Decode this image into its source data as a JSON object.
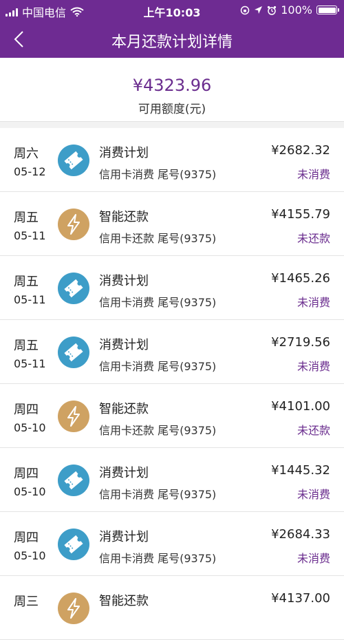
{
  "status_bar": {
    "carrier": "中国电信",
    "time": "上午10:03",
    "battery": "100%"
  },
  "nav": {
    "title": "本月还款计划详情"
  },
  "summary": {
    "amount": "¥4323.96",
    "label": "可用额度(元)"
  },
  "colors": {
    "brand": "#6e2b92",
    "consume_icon": "#3d9dc8",
    "repay_icon": "#cfa262",
    "status_text": "#6a2c8e"
  },
  "items": [
    {
      "weekday": "周六",
      "date": "05-12",
      "type": "consume",
      "icon": "ticket-icon",
      "name": "消费计划",
      "card": "信用卡消费  尾号(9375)",
      "amount": "¥2682.32",
      "status": "未消费"
    },
    {
      "weekday": "周五",
      "date": "05-11",
      "type": "repay",
      "icon": "lightning-icon",
      "name": "智能还款",
      "card": "信用卡还款  尾号(9375)",
      "amount": "¥4155.79",
      "status": "未还款"
    },
    {
      "weekday": "周五",
      "date": "05-11",
      "type": "consume",
      "icon": "ticket-icon",
      "name": "消费计划",
      "card": "信用卡消费  尾号(9375)",
      "amount": "¥1465.26",
      "status": "未消费"
    },
    {
      "weekday": "周五",
      "date": "05-11",
      "type": "consume",
      "icon": "ticket-icon",
      "name": "消费计划",
      "card": "信用卡消费  尾号(9375)",
      "amount": "¥2719.56",
      "status": "未消费"
    },
    {
      "weekday": "周四",
      "date": "05-10",
      "type": "repay",
      "icon": "lightning-icon",
      "name": "智能还款",
      "card": "信用卡还款  尾号(9375)",
      "amount": "¥4101.00",
      "status": "未还款"
    },
    {
      "weekday": "周四",
      "date": "05-10",
      "type": "consume",
      "icon": "ticket-icon",
      "name": "消费计划",
      "card": "信用卡消费  尾号(9375)",
      "amount": "¥1445.32",
      "status": "未消费"
    },
    {
      "weekday": "周四",
      "date": "05-10",
      "type": "consume",
      "icon": "ticket-icon",
      "name": "消费计划",
      "card": "信用卡消费  尾号(9375)",
      "amount": "¥2684.33",
      "status": "未消费"
    },
    {
      "weekday": "周三",
      "date": "",
      "type": "repay",
      "icon": "lightning-icon",
      "name": "智能还款",
      "card": "",
      "amount": "¥4137.00",
      "status": ""
    }
  ]
}
